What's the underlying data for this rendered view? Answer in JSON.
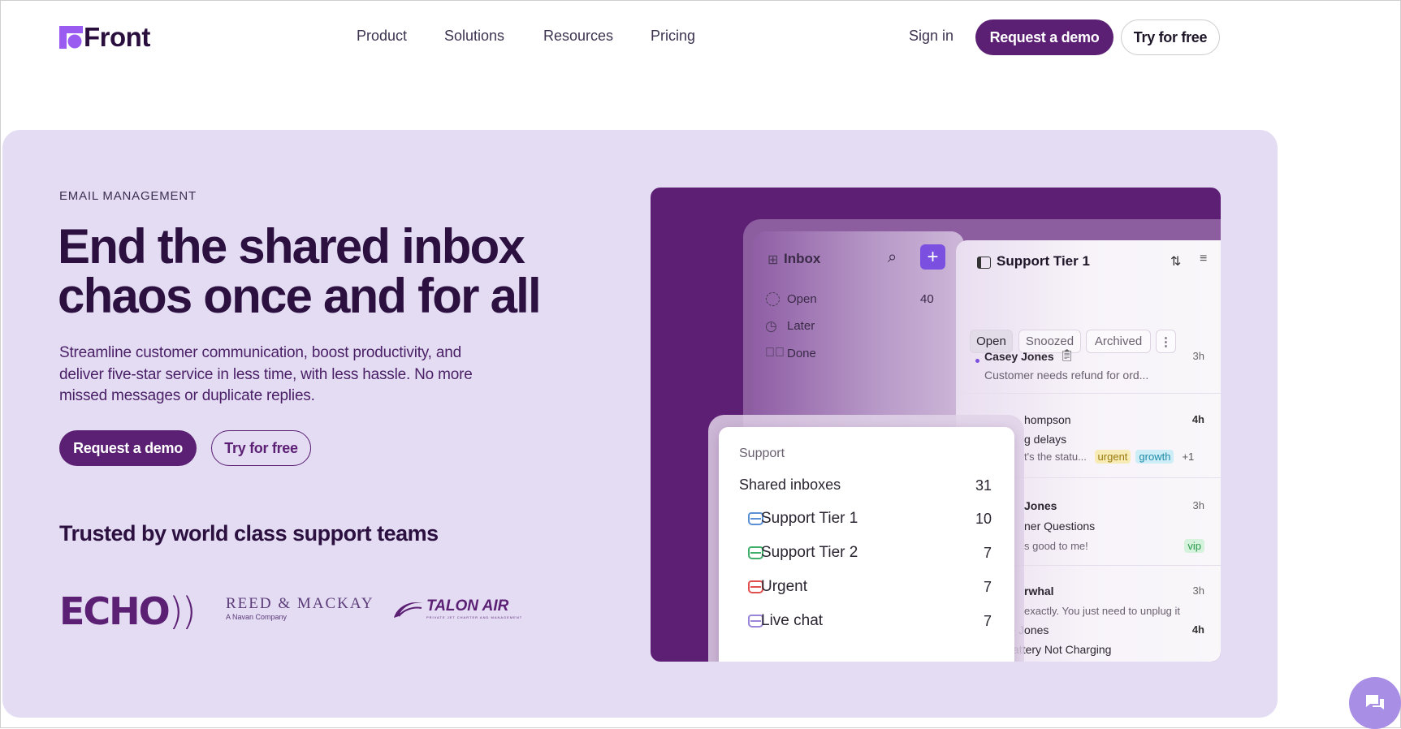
{
  "header": {
    "logo": "Front",
    "nav": [
      "Product",
      "Solutions",
      "Resources",
      "Pricing"
    ],
    "sign_in": "Sign in",
    "request_demo": "Request a demo",
    "try_free": "Try for free"
  },
  "hero": {
    "eyebrow": "EMAIL MANAGEMENT",
    "title_line1": "End the shared inbox",
    "title_line2": "chaos once and for all",
    "description": "Streamline customer communication, boost productivity, and deliver five-star service in less time, with less hassle. No more missed messages or duplicate replies.",
    "request_demo": "Request a demo",
    "try_free": "Try for free",
    "trusted": "Trusted by world class support teams",
    "logos": {
      "echo": "ECHO",
      "reed": "REED & MACKAY",
      "reed_sub": "A Navan Company",
      "talon": "TALON AIR",
      "talon_sub": "PRIVATE JET CHARTER AND MANAGEMENT"
    }
  },
  "mockup": {
    "sidebar": {
      "title": "Inbox",
      "items": [
        {
          "label": "Open",
          "count": "40"
        },
        {
          "label": "Later"
        },
        {
          "label": "Done"
        }
      ]
    },
    "panel": {
      "title": "Support Tier 1",
      "tabs": [
        "Open",
        "Snoozed",
        "Archived"
      ],
      "rows": [
        {
          "name": "Casey Jones",
          "time": "3h",
          "preview": "Customer needs refund for ord..."
        },
        {
          "name": "hompson",
          "time": "4h",
          "subject": "g delays",
          "preview": "t's the statu...",
          "tags": [
            "urgent",
            "growth",
            "+1"
          ]
        },
        {
          "name": "Jones",
          "time": "3h",
          "subject": "ner Questions",
          "preview": "s good to me!",
          "tags": [
            "vip"
          ]
        },
        {
          "name": "rwhal",
          "time": "3h",
          "preview": "exactly. You just need to unplug it"
        },
        {
          "name": "Lance Jones",
          "time": "4h",
          "subject": "Re: Battery Not Charging"
        }
      ]
    },
    "popup": {
      "section": "Support",
      "group": "Shared inboxes",
      "group_count": "31",
      "items": [
        {
          "label": "Support Tier 1",
          "count": "10",
          "color": "#5b8fd6"
        },
        {
          "label": "Support Tier 2",
          "count": "7",
          "color": "#3fae6a"
        },
        {
          "label": "Urgent",
          "count": "7",
          "color": "#e0504f"
        },
        {
          "label": "Live chat",
          "count": "7",
          "color": "#9a85d8"
        }
      ]
    }
  },
  "colors": {
    "brand": "#5b1f73",
    "hero_bg": "#e3dcf3",
    "accent": "#7b4fe0"
  }
}
